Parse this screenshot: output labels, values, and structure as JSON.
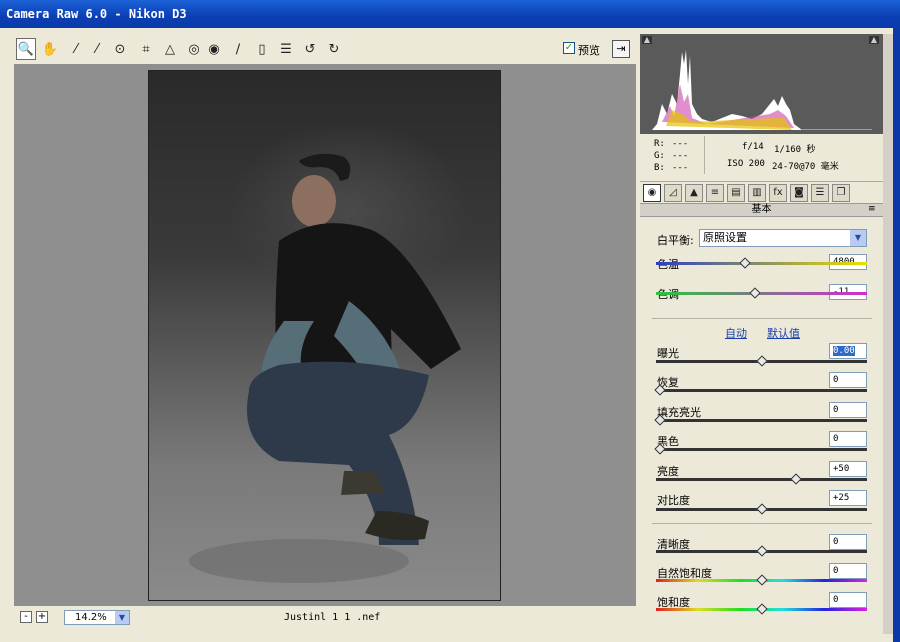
{
  "window": {
    "title": "Camera Raw 6.0 -  Nikon D3"
  },
  "toolbar": {
    "tools": [
      {
        "name": "zoom-tool-icon",
        "glyph": "🔍"
      },
      {
        "name": "hand-tool-icon",
        "glyph": "✋"
      },
      {
        "name": "white-balance-tool-icon",
        "glyph": "⁄"
      },
      {
        "name": "color-sampler-tool-icon",
        "glyph": "⁄"
      },
      {
        "name": "targeted-adjustment-tool-icon",
        "glyph": "⊙"
      },
      {
        "name": "crop-tool-icon",
        "glyph": "⌗"
      },
      {
        "name": "straighten-tool-icon",
        "glyph": "△"
      },
      {
        "name": "spot-removal-tool-icon",
        "glyph": "◎"
      },
      {
        "name": "red-eye-tool-icon",
        "glyph": "◉"
      },
      {
        "name": "adjustment-brush-icon",
        "glyph": "∕"
      },
      {
        "name": "graduated-filter-icon",
        "glyph": "▯"
      },
      {
        "name": "preferences-icon",
        "glyph": "☰"
      },
      {
        "name": "rotate-left-icon",
        "glyph": "↺"
      },
      {
        "name": "rotate-right-icon",
        "glyph": "↻"
      }
    ],
    "preview_label": "预览",
    "preview_checked": "✓"
  },
  "status": {
    "zoom_minus": "-",
    "zoom_plus": "+",
    "zoom_value": "14.2%",
    "filename": "Justinl 1 1 .nef"
  },
  "histogram": {
    "r_label": "R:",
    "g_label": "G:",
    "b_label": "B:",
    "r_value": "---",
    "g_value": "---",
    "b_value": "---",
    "aperture": "f/14",
    "shutter": "1/160 秒",
    "iso": "ISO 200",
    "lens": "24-70@70 毫米"
  },
  "panel": {
    "title": "基本",
    "white_balance_label": "白平衡:",
    "white_balance_value": "原照设置",
    "auto_link": "自动",
    "default_link": "默认值",
    "sliders": {
      "temperature": {
        "label": "色温",
        "value": "4800",
        "level": 0.42
      },
      "tint": {
        "label": "色调",
        "value": "-11",
        "level": 0.47
      },
      "exposure": {
        "label": "曝光",
        "value": "0.00",
        "level": 0.5
      },
      "recovery": {
        "label": "恢复",
        "value": "0",
        "level": 0.0
      },
      "fill_light": {
        "label": "填充亮光",
        "value": "0",
        "level": 0.0
      },
      "blacks": {
        "label": "黑色",
        "value": "0",
        "level": 0.0
      },
      "brightness": {
        "label": "亮度",
        "value": "+50",
        "level": 0.67
      },
      "contrast": {
        "label": "对比度",
        "value": "+25",
        "level": 0.5
      },
      "clarity": {
        "label": "清晰度",
        "value": "0",
        "level": 0.5
      },
      "vibrance": {
        "label": "自然饱和度",
        "value": "0",
        "level": 0.5
      },
      "saturation": {
        "label": "饱和度",
        "value": "0",
        "level": 0.5
      }
    }
  },
  "colors": {
    "title_bar": "#0a3fb4",
    "panel_bg": "#ece9d8",
    "canvas_bg": "#8f8f8f",
    "link": "#1a3ea8"
  }
}
